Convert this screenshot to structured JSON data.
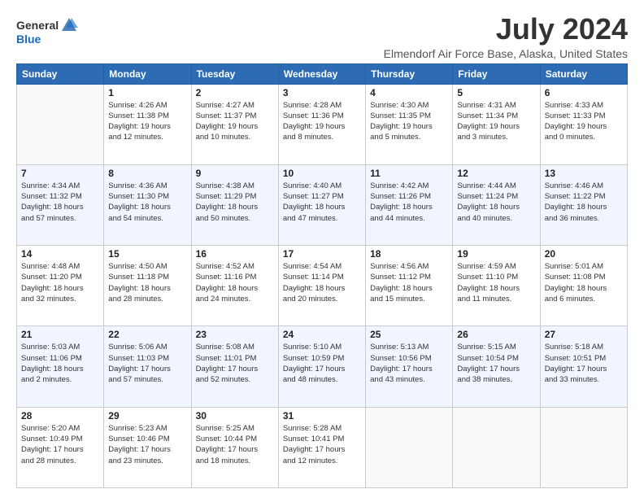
{
  "logo": {
    "general": "General",
    "blue": "Blue"
  },
  "title": "July 2024",
  "subtitle": "Elmendorf Air Force Base, Alaska, United States",
  "days_of_week": [
    "Sunday",
    "Monday",
    "Tuesday",
    "Wednesday",
    "Thursday",
    "Friday",
    "Saturday"
  ],
  "weeks": [
    [
      {
        "day": "",
        "sunrise": "",
        "sunset": "",
        "daylight": ""
      },
      {
        "day": "1",
        "sunrise": "Sunrise: 4:26 AM",
        "sunset": "Sunset: 11:38 PM",
        "daylight": "Daylight: 19 hours and 12 minutes."
      },
      {
        "day": "2",
        "sunrise": "Sunrise: 4:27 AM",
        "sunset": "Sunset: 11:37 PM",
        "daylight": "Daylight: 19 hours and 10 minutes."
      },
      {
        "day": "3",
        "sunrise": "Sunrise: 4:28 AM",
        "sunset": "Sunset: 11:36 PM",
        "daylight": "Daylight: 19 hours and 8 minutes."
      },
      {
        "day": "4",
        "sunrise": "Sunrise: 4:30 AM",
        "sunset": "Sunset: 11:35 PM",
        "daylight": "Daylight: 19 hours and 5 minutes."
      },
      {
        "day": "5",
        "sunrise": "Sunrise: 4:31 AM",
        "sunset": "Sunset: 11:34 PM",
        "daylight": "Daylight: 19 hours and 3 minutes."
      },
      {
        "day": "6",
        "sunrise": "Sunrise: 4:33 AM",
        "sunset": "Sunset: 11:33 PM",
        "daylight": "Daylight: 19 hours and 0 minutes."
      }
    ],
    [
      {
        "day": "7",
        "sunrise": "Sunrise: 4:34 AM",
        "sunset": "Sunset: 11:32 PM",
        "daylight": "Daylight: 18 hours and 57 minutes."
      },
      {
        "day": "8",
        "sunrise": "Sunrise: 4:36 AM",
        "sunset": "Sunset: 11:30 PM",
        "daylight": "Daylight: 18 hours and 54 minutes."
      },
      {
        "day": "9",
        "sunrise": "Sunrise: 4:38 AM",
        "sunset": "Sunset: 11:29 PM",
        "daylight": "Daylight: 18 hours and 50 minutes."
      },
      {
        "day": "10",
        "sunrise": "Sunrise: 4:40 AM",
        "sunset": "Sunset: 11:27 PM",
        "daylight": "Daylight: 18 hours and 47 minutes."
      },
      {
        "day": "11",
        "sunrise": "Sunrise: 4:42 AM",
        "sunset": "Sunset: 11:26 PM",
        "daylight": "Daylight: 18 hours and 44 minutes."
      },
      {
        "day": "12",
        "sunrise": "Sunrise: 4:44 AM",
        "sunset": "Sunset: 11:24 PM",
        "daylight": "Daylight: 18 hours and 40 minutes."
      },
      {
        "day": "13",
        "sunrise": "Sunrise: 4:46 AM",
        "sunset": "Sunset: 11:22 PM",
        "daylight": "Daylight: 18 hours and 36 minutes."
      }
    ],
    [
      {
        "day": "14",
        "sunrise": "Sunrise: 4:48 AM",
        "sunset": "Sunset: 11:20 PM",
        "daylight": "Daylight: 18 hours and 32 minutes."
      },
      {
        "day": "15",
        "sunrise": "Sunrise: 4:50 AM",
        "sunset": "Sunset: 11:18 PM",
        "daylight": "Daylight: 18 hours and 28 minutes."
      },
      {
        "day": "16",
        "sunrise": "Sunrise: 4:52 AM",
        "sunset": "Sunset: 11:16 PM",
        "daylight": "Daylight: 18 hours and 24 minutes."
      },
      {
        "day": "17",
        "sunrise": "Sunrise: 4:54 AM",
        "sunset": "Sunset: 11:14 PM",
        "daylight": "Daylight: 18 hours and 20 minutes."
      },
      {
        "day": "18",
        "sunrise": "Sunrise: 4:56 AM",
        "sunset": "Sunset: 11:12 PM",
        "daylight": "Daylight: 18 hours and 15 minutes."
      },
      {
        "day": "19",
        "sunrise": "Sunrise: 4:59 AM",
        "sunset": "Sunset: 11:10 PM",
        "daylight": "Daylight: 18 hours and 11 minutes."
      },
      {
        "day": "20",
        "sunrise": "Sunrise: 5:01 AM",
        "sunset": "Sunset: 11:08 PM",
        "daylight": "Daylight: 18 hours and 6 minutes."
      }
    ],
    [
      {
        "day": "21",
        "sunrise": "Sunrise: 5:03 AM",
        "sunset": "Sunset: 11:06 PM",
        "daylight": "Daylight: 18 hours and 2 minutes."
      },
      {
        "day": "22",
        "sunrise": "Sunrise: 5:06 AM",
        "sunset": "Sunset: 11:03 PM",
        "daylight": "Daylight: 17 hours and 57 minutes."
      },
      {
        "day": "23",
        "sunrise": "Sunrise: 5:08 AM",
        "sunset": "Sunset: 11:01 PM",
        "daylight": "Daylight: 17 hours and 52 minutes."
      },
      {
        "day": "24",
        "sunrise": "Sunrise: 5:10 AM",
        "sunset": "Sunset: 10:59 PM",
        "daylight": "Daylight: 17 hours and 48 minutes."
      },
      {
        "day": "25",
        "sunrise": "Sunrise: 5:13 AM",
        "sunset": "Sunset: 10:56 PM",
        "daylight": "Daylight: 17 hours and 43 minutes."
      },
      {
        "day": "26",
        "sunrise": "Sunrise: 5:15 AM",
        "sunset": "Sunset: 10:54 PM",
        "daylight": "Daylight: 17 hours and 38 minutes."
      },
      {
        "day": "27",
        "sunrise": "Sunrise: 5:18 AM",
        "sunset": "Sunset: 10:51 PM",
        "daylight": "Daylight: 17 hours and 33 minutes."
      }
    ],
    [
      {
        "day": "28",
        "sunrise": "Sunrise: 5:20 AM",
        "sunset": "Sunset: 10:49 PM",
        "daylight": "Daylight: 17 hours and 28 minutes."
      },
      {
        "day": "29",
        "sunrise": "Sunrise: 5:23 AM",
        "sunset": "Sunset: 10:46 PM",
        "daylight": "Daylight: 17 hours and 23 minutes."
      },
      {
        "day": "30",
        "sunrise": "Sunrise: 5:25 AM",
        "sunset": "Sunset: 10:44 PM",
        "daylight": "Daylight: 17 hours and 18 minutes."
      },
      {
        "day": "31",
        "sunrise": "Sunrise: 5:28 AM",
        "sunset": "Sunset: 10:41 PM",
        "daylight": "Daylight: 17 hours and 12 minutes."
      },
      {
        "day": "",
        "sunrise": "",
        "sunset": "",
        "daylight": ""
      },
      {
        "day": "",
        "sunrise": "",
        "sunset": "",
        "daylight": ""
      },
      {
        "day": "",
        "sunrise": "",
        "sunset": "",
        "daylight": ""
      }
    ]
  ]
}
